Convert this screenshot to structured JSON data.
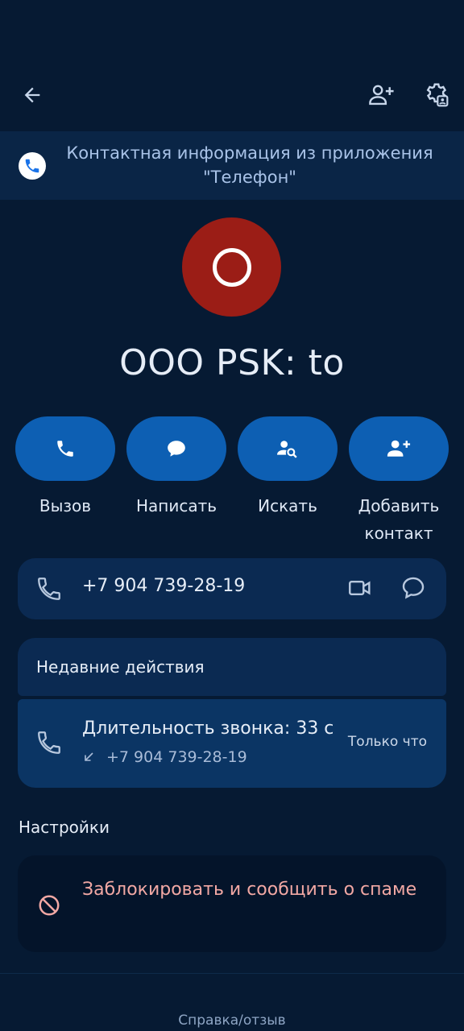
{
  "banner": {
    "text": "Контактная информация из приложения \"Телефон\""
  },
  "contact": {
    "name": "OOO PSK: to",
    "avatar_letter": "O",
    "avatar_color": "#9b1d16"
  },
  "actions": [
    {
      "label": "Вызов",
      "icon": "phone-icon"
    },
    {
      "label": "Написать",
      "icon": "chat-bubble-icon"
    },
    {
      "label": "Искать",
      "icon": "person-search-icon"
    },
    {
      "label": "Добавить контакт",
      "icon": "person-add-icon"
    }
  ],
  "phone": {
    "number": "+7 904 739-28-19"
  },
  "recent": {
    "title": "Недавние действия",
    "item": {
      "duration": "Длительность звонка: 33 с",
      "number": "+7 904 739-28-19",
      "time": "Только что"
    }
  },
  "settings": {
    "title": "Настройки",
    "block_label": "Заблокировать и сообщить о спаме"
  },
  "footer": {
    "help": "Справка/отзыв"
  },
  "colors": {
    "background": "#061a33",
    "accent": "#0d5fb3",
    "danger_text": "#f2a8a4"
  }
}
